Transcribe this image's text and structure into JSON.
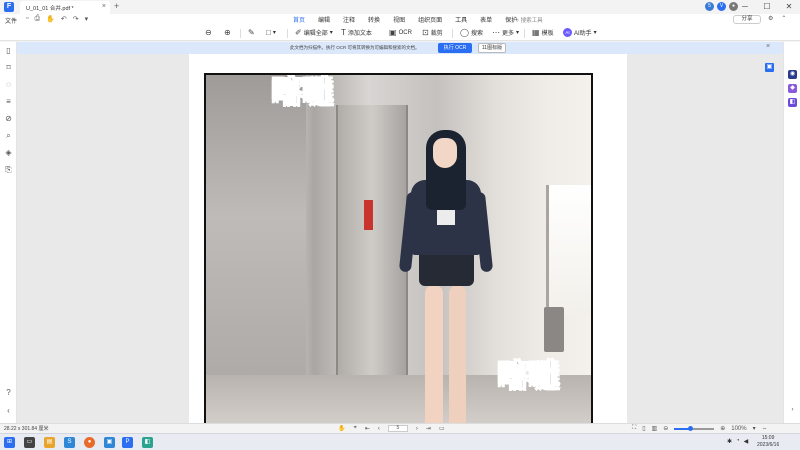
{
  "titlebar": {
    "tab_title": "U_01_01 合并.pdf *",
    "tab_close": "×",
    "new_tab": "+",
    "window_controls": [
      "─",
      "☐",
      "✕"
    ],
    "avatars": [
      {
        "label": "5",
        "color": "#3a7bd5"
      },
      {
        "label": "V",
        "color": "#2b6ef2"
      },
      {
        "label": "●",
        "color": "#777777"
      }
    ]
  },
  "menubar": {
    "file_label": "文件",
    "tabs": [
      {
        "label": "首页",
        "active": true
      },
      {
        "label": "编辑",
        "active": false
      },
      {
        "label": "注释",
        "active": false
      },
      {
        "label": "转换",
        "active": false
      },
      {
        "label": "视图",
        "active": false
      },
      {
        "label": "组织页面",
        "active": false
      },
      {
        "label": "工具",
        "active": false
      },
      {
        "label": "表单",
        "active": false
      },
      {
        "label": "保护",
        "active": false
      }
    ],
    "search_placeholder": "⌕ 搜索工具",
    "share_label": "分享"
  },
  "toolbar": {
    "edit_all": "编辑全部",
    "add_text": "添加文本",
    "ocr": "OCR",
    "crop": "裁剪",
    "search": "搜索",
    "more": "更多",
    "template": "模板",
    "ai_assistant": "AI助手",
    "ai_badge": "AI"
  },
  "notice": {
    "text": "此文档为扫描件。执行 OCR 可将其转换为可编辑和搜索的文档。",
    "ocr_button": "执行 OCR",
    "ignore_button": "11图标版"
  },
  "comic": {
    "sfx_top": "喀噠",
    "sfx_bottom": "喀噠"
  },
  "statusbar": {
    "dimensions": "28.22 x 301.84 厘米",
    "page_value": "5",
    "zoom_label": "100%",
    "zoom_fraction": 0.4
  },
  "taskbar": {
    "clock_time": "15:09",
    "clock_date": "2023/6/16",
    "icons": [
      {
        "label": "⊞",
        "color": "#2b6ef2"
      },
      {
        "label": "▭",
        "color": "#444444"
      },
      {
        "label": "▤",
        "color": "#e9a52b"
      },
      {
        "label": "S",
        "color": "#2f87d8"
      },
      {
        "label": "●",
        "color": "#e86b2a"
      },
      {
        "label": "▣",
        "color": "#2f87d8"
      },
      {
        "label": "P",
        "color": "#2b6ef2"
      },
      {
        "label": "◧",
        "color": "#2aa38f"
      }
    ]
  }
}
